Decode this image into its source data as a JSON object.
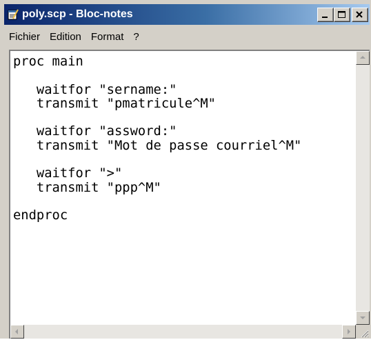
{
  "window": {
    "title": "poly.scp - Bloc-notes",
    "app_icon": "notepad-icon",
    "controls": [
      "minimize-icon",
      "maximize-icon",
      "close-icon"
    ]
  },
  "menu": {
    "items": [
      {
        "label": "Fichier"
      },
      {
        "label": "Edition"
      },
      {
        "label": "Format"
      },
      {
        "label": "?"
      }
    ]
  },
  "editor": {
    "content": "proc main\n\n   waitfor \"sername:\"\n   transmit \"pmatricule^M\"\n\n   waitfor \"assword:\"\n   transmit \"Mot de passe courriel^M\"\n\n   waitfor \">\"\n   transmit \"ppp^M\"\n\nendproc"
  },
  "colors": {
    "titlebar_start": "#0a246a",
    "titlebar_end": "#a6caf0",
    "chrome": "#d4d0c8"
  }
}
